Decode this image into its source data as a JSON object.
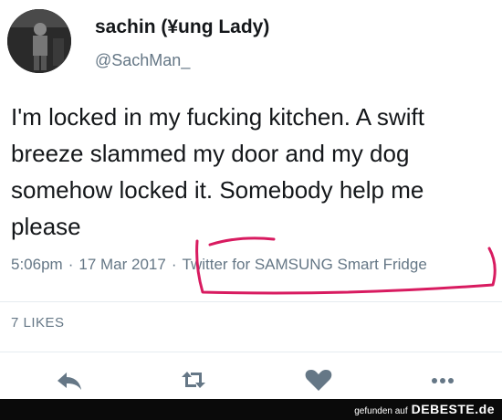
{
  "user": {
    "display_name": "sachin (¥ung Lady)",
    "handle": "@SachMan_"
  },
  "tweet": {
    "text": "I'm locked in my fucking kitchen. A swift breeze slammed my door and my dog somehow locked it. Somebody help me please",
    "time": "5:06pm",
    "separator": "·",
    "date": "17 Mar 2017",
    "source": "Twitter for SAMSUNG Smart Fridge",
    "likes": "7 LIKES"
  },
  "actions": {
    "icons": [
      "reply-icon",
      "retweet-icon",
      "like-icon",
      "more-icon"
    ],
    "color": "#657786"
  },
  "annotation": {
    "color": "#d81b60"
  },
  "footer": {
    "small_text": "gefunden auf",
    "brand": "DEBESTE.de"
  }
}
